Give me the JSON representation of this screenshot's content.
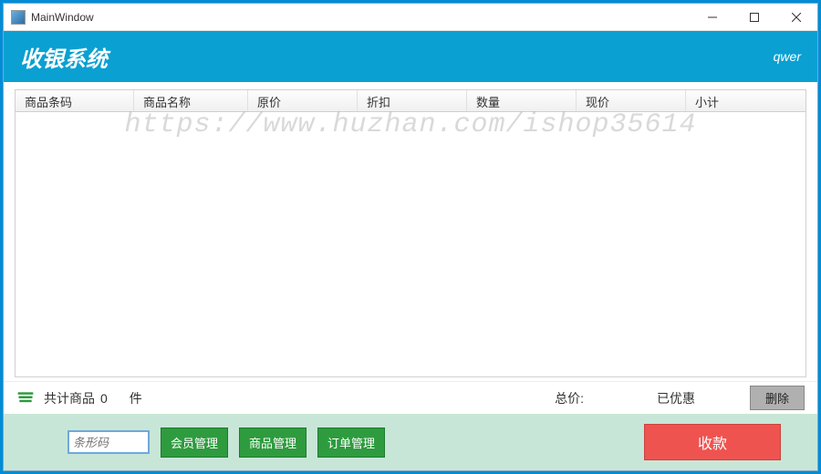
{
  "window": {
    "title": "MainWindow"
  },
  "header": {
    "app_title": "收银系统",
    "user": "qwer"
  },
  "table": {
    "columns": [
      "商品条码",
      "商品名称",
      "原价",
      "折扣",
      "数量",
      "现价",
      "小计"
    ],
    "rows": []
  },
  "summary": {
    "count_label_prefix": "共计商品",
    "count_value": "0",
    "unit": "件",
    "total_label": "总价:",
    "total_value": "",
    "discount_label": "已优惠",
    "discount_value": "",
    "delete_label": "删除"
  },
  "actions": {
    "barcode_placeholder": "条形码",
    "member_btn": "会员管理",
    "product_btn": "商品管理",
    "order_btn": "订单管理",
    "pay_btn": "收款"
  },
  "watermark": "https://www.huzhan.com/ishop35614"
}
